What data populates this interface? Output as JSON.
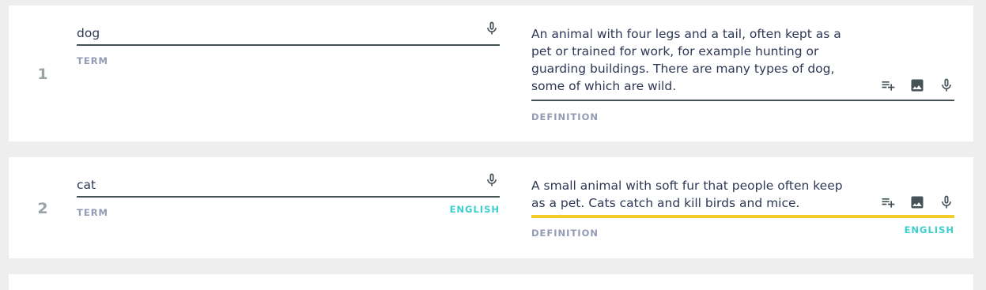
{
  "cards": [
    {
      "number": "1",
      "term": {
        "value": "dog",
        "label": "TERM",
        "language": ""
      },
      "definition": {
        "value": "An animal with four legs and a tail, often kept as a pet or trained for work, for example hunting or guarding buildings. There are many types of dog, some of which are wild.",
        "label": "DEFINITION",
        "language": ""
      }
    },
    {
      "number": "2",
      "term": {
        "value": "cat",
        "label": "TERM",
        "language": "ENGLISH"
      },
      "definition": {
        "value": "A small animal with soft fur that people often keep as a pet. Cats catch and kill birds and mice.",
        "label": "DEFINITION",
        "language": "ENGLISH"
      }
    }
  ],
  "icons": {
    "mic": "microphone-icon",
    "add_list": "playlist-add-icon",
    "image": "image-icon"
  },
  "colors": {
    "active_underline": "#f3cc2b",
    "language_label": "#3ccfcf",
    "field_underline": "#455358",
    "label": "#939bb4",
    "number": "#9aa3a6"
  }
}
